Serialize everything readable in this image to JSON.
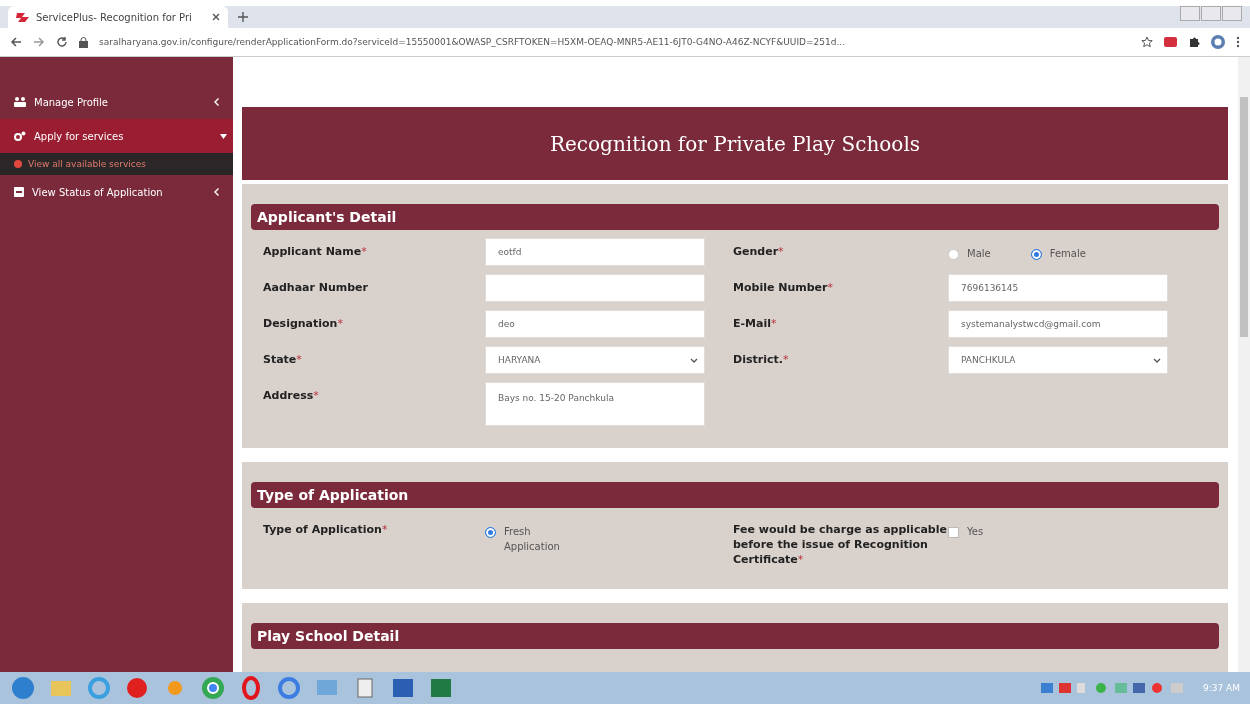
{
  "browser": {
    "tab_title": "ServicePlus- Recognition for Pri",
    "url": "saralharyana.gov.in/configure/renderApplicationForm.do?serviceId=15550001&OWASP_CSRFTOKEN=H5XM-OEAQ-MNR5-AE11-6JT0-G4NO-A46Z-NCYF&UUID=251d..."
  },
  "sidebar": {
    "items": [
      {
        "label": "Manage Profile",
        "expanded": false,
        "selected": false
      },
      {
        "label": "Apply for services",
        "expanded": true,
        "selected": true,
        "children": [
          {
            "label": "View all available services",
            "selected": true
          }
        ]
      },
      {
        "label": "View Status of Application",
        "expanded": false,
        "selected": false
      }
    ]
  },
  "form": {
    "title": "Recognition for Private Play Schools",
    "sections": [
      {
        "title": "Applicant's Detail",
        "fields": [
          {
            "label": "Applicant Name",
            "required_mark": "*",
            "kind": "text",
            "value": "eotfd"
          },
          {
            "label": "Gender",
            "required_mark": "*",
            "kind": "radio",
            "options": [
              {
                "label": "Male",
                "selected": false
              },
              {
                "label": "Female",
                "selected": true
              }
            ]
          },
          {
            "label": "Aadhaar Number",
            "kind": "text"
          },
          {
            "label": "Mobile Number",
            "required_mark": "*",
            "kind": "text",
            "value": "7696136145"
          },
          {
            "label": "Designation",
            "required_mark": "*",
            "kind": "text",
            "value": "deo"
          },
          {
            "label": "E-Mail",
            "required_mark": "*",
            "kind": "text",
            "value": "systemanalystwcd@gmail.com"
          },
          {
            "label": "State",
            "required_mark": "*",
            "kind": "select",
            "value": "HARYANA"
          },
          {
            "label": "District.",
            "required_mark": "*",
            "kind": "select",
            "value": "PANCHKULA"
          },
          {
            "label": "Address",
            "required_mark": "*",
            "kind": "textarea",
            "value": "Bays no. 15-20 Panchkula"
          }
        ]
      },
      {
        "title": "Type of Application",
        "fields": [
          {
            "label": "Type of Application",
            "required_mark": "*",
            "kind": "radio",
            "options": [
              {
                "label": "Fresh Application",
                "selected": true
              }
            ]
          },
          {
            "label": "Fee would be charge as applicable before the issue of Recognition Certificate",
            "required_mark": "*",
            "kind": "checkbox",
            "options": [
              {
                "label": "Yes",
                "checked": false
              }
            ]
          }
        ]
      },
      {
        "title": "Play School Detail"
      }
    ]
  },
  "taskbar": {
    "clock": "9:37 AM"
  }
}
